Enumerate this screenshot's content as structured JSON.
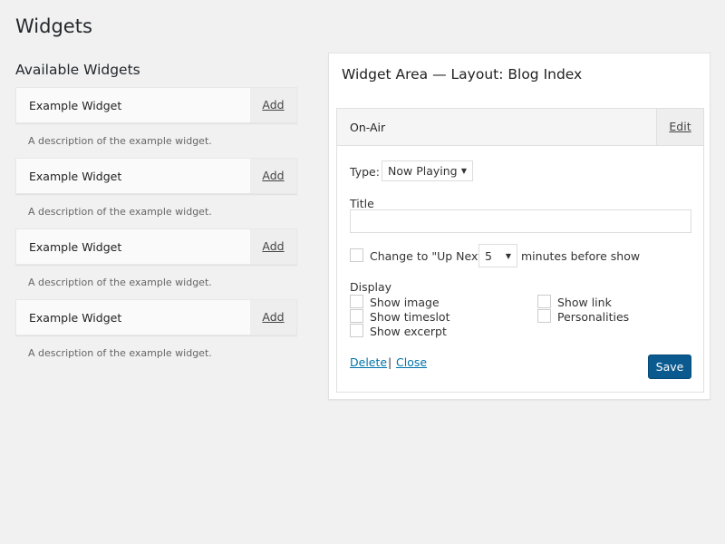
{
  "page_title": "Widgets",
  "available": {
    "heading": "Available Widgets",
    "items": [
      {
        "name": "Example Widget",
        "add": "Add",
        "desc": "A description of the example widget."
      },
      {
        "name": "Example Widget",
        "add": "Add",
        "desc": "A description of the example widget."
      },
      {
        "name": "Example Widget",
        "add": "Add",
        "desc": "A description of the example widget."
      },
      {
        "name": "Example Widget",
        "add": "Add",
        "desc": "A description of the example widget."
      }
    ]
  },
  "area": {
    "title": "Widget Area — Layout: Blog Index",
    "widget": {
      "name": "On-Air",
      "edit": "Edit",
      "type_label": "Type:",
      "type_value": "Now Playing",
      "title_label": "Title",
      "title_value": "",
      "upnext_label": "Change to \"Up Next\"",
      "minutes_value": "5",
      "minutes_suffix": "minutes before show",
      "display_label": "Display",
      "options": [
        "Show image",
        "Show timeslot",
        "Show excerpt",
        "Show link",
        "Personalities"
      ],
      "delete": "Delete",
      "sep": "|",
      "close": "Close",
      "save": "Save"
    }
  },
  "colors": {
    "accent": "#0b5a8f",
    "link": "#0073aa"
  }
}
